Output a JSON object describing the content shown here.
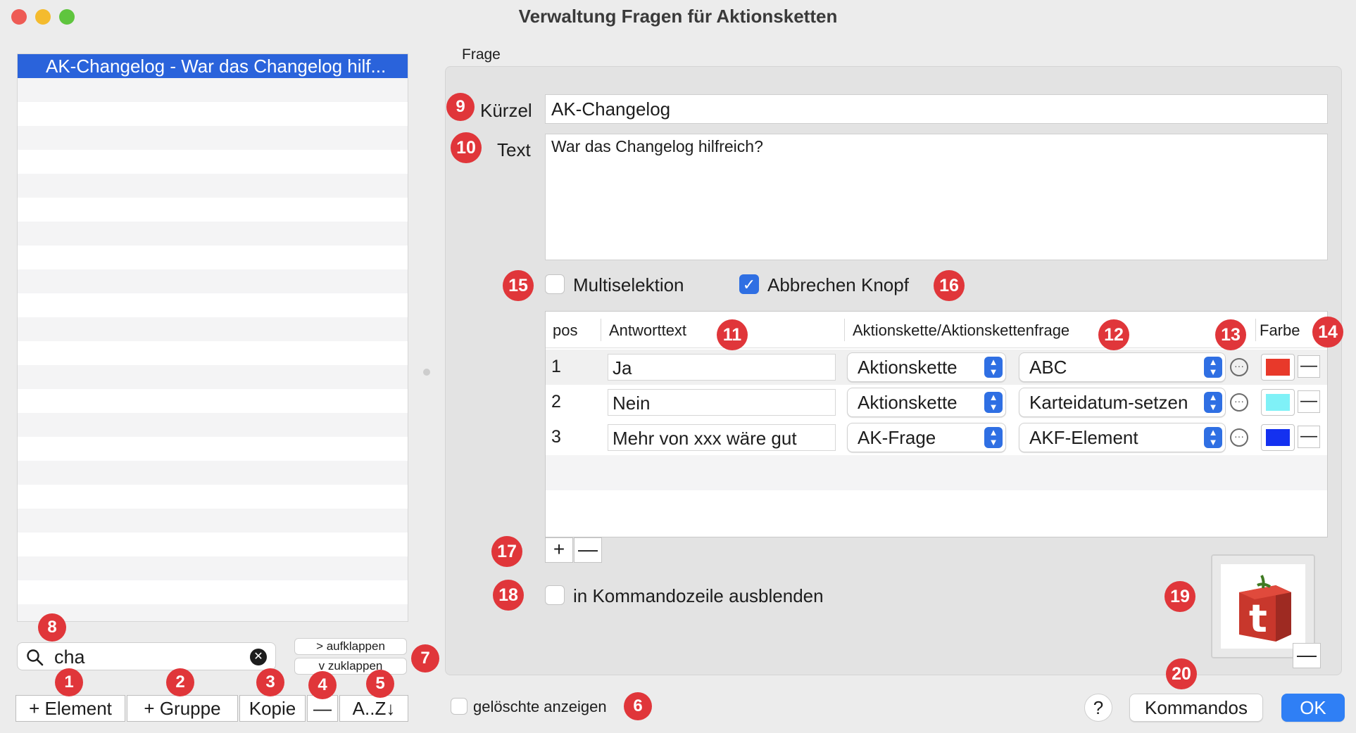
{
  "window": {
    "title": "Verwaltung Fragen für Aktionsketten"
  },
  "sidebar": {
    "selected_item": "AK-Changelog - War das Changelog hilf...",
    "search": {
      "value": "cha"
    },
    "expand_label": "> aufklappen",
    "collapse_label": "v  zuklappen",
    "buttons": {
      "element": "+ Element",
      "group": "+ Gruppe",
      "copy": "Kopie",
      "remove": "—",
      "sort": "A..Z↓"
    }
  },
  "form": {
    "section_label": "Frage",
    "kuerzel_label": "Kürzel",
    "kuerzel_value": "AK-Changelog",
    "text_label": "Text",
    "text_value": "War das Changelog hilfreich?",
    "multiselect_label": "Multiselektion",
    "multiselect_checked": false,
    "cancel_button_label": "Abbrechen Knopf",
    "cancel_button_checked": true,
    "table": {
      "headers": {
        "pos": "pos",
        "answer": "Antworttext",
        "chain": "Aktionskette/Aktionskettenfrage",
        "color": "Farbe"
      },
      "rows": [
        {
          "pos": "1",
          "answer": "Ja",
          "type": "Aktionskette",
          "target": "ABC",
          "color": "#e8392a"
        },
        {
          "pos": "2",
          "answer": "Nein",
          "type": "Aktionskette",
          "target": "Karteidatum-setzen",
          "color": "#7ff1f7"
        },
        {
          "pos": "3",
          "answer": "Mehr von xxx wäre gut",
          "type": "AK-Frage",
          "target": "AKF-Element",
          "color": "#1431f0"
        }
      ]
    },
    "add_row": "+",
    "remove_row": "—",
    "hide_cmdline_label": "in Kommandozeile ausblenden",
    "hide_cmdline_checked": false,
    "image_remove": "—"
  },
  "footer": {
    "show_deleted_label": "gelöschte anzeigen",
    "help": "?",
    "commands": "Kommandos",
    "ok": "OK"
  },
  "badges": {
    "b1": "1",
    "b2": "2",
    "b3": "3",
    "b4": "4",
    "b5": "5",
    "b6": "6",
    "b7": "7",
    "b8": "8",
    "b9": "9",
    "b10": "10",
    "b11": "11",
    "b12": "12",
    "b13": "13",
    "b14": "14",
    "b15": "15",
    "b16": "16",
    "b17": "17",
    "b18": "18",
    "b19": "19",
    "b20": "20"
  },
  "colors": {
    "accent": "#2f6fe3",
    "badge": "#e0363a",
    "selection": "#2a63db"
  },
  "icons": {
    "search": "search-icon",
    "clear": "clear-icon",
    "more": "ellipsis-circle-icon",
    "app": "tomato-t-logo"
  }
}
